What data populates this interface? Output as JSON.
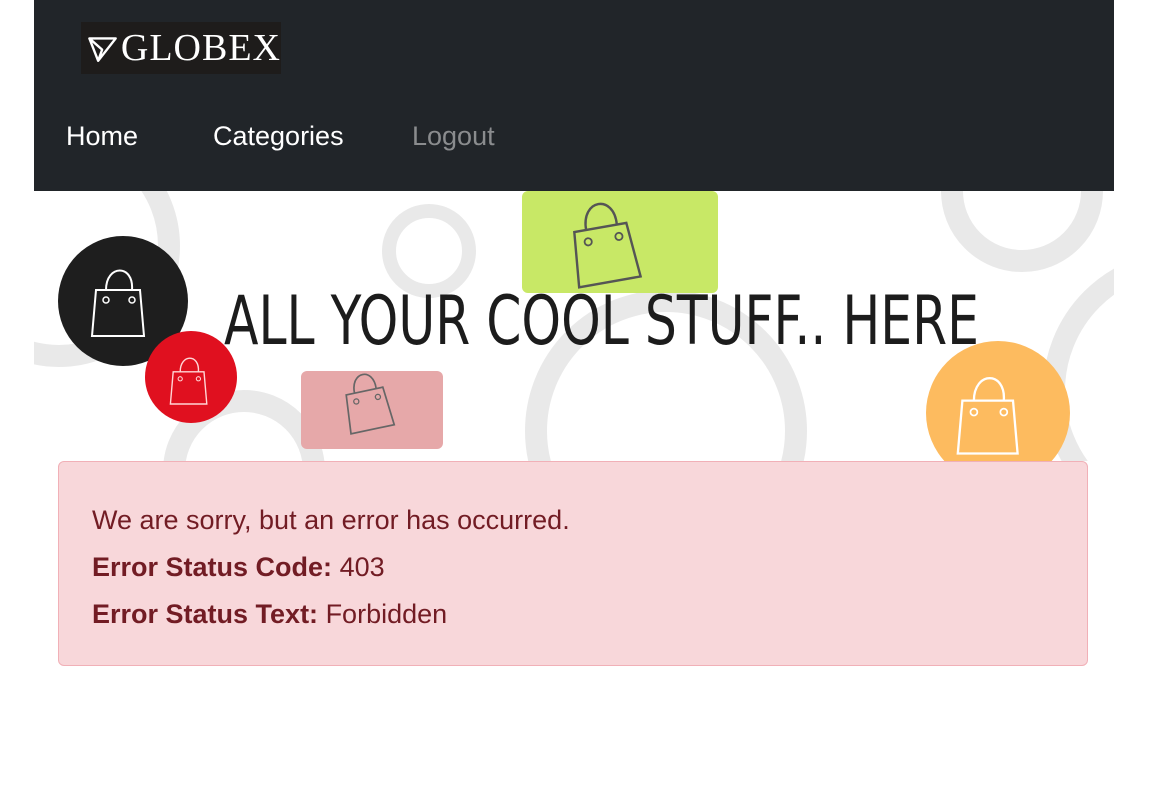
{
  "brand": {
    "name": "GLOBEX",
    "logo_icon": "paper-plane-icon"
  },
  "nav": {
    "items": [
      {
        "label": "Home"
      },
      {
        "label": "Categories"
      },
      {
        "label": "Logout"
      }
    ]
  },
  "hero": {
    "headline": "ALL YOUR COOL STUFF.. HERE",
    "decor_icons": [
      "shopping-bag-icon"
    ],
    "colors": {
      "black_circle": "#1e1e1e",
      "red_circle": "#e0101f",
      "green_square": "#c8e866",
      "pink_square": "#e6a8a9",
      "orange_circle": "#fdbb5f",
      "ring": "#e9e9e9"
    }
  },
  "error": {
    "message": "We are sorry, but an error has occurred.",
    "status_code_label": "Error Status Code:",
    "status_code_value": "403",
    "status_text_label": "Error Status Text:",
    "status_text_value": "Forbidden"
  },
  "colors": {
    "navbar_bg": "#212529",
    "alert_bg": "#f8d7da",
    "alert_border": "#f1b0b7",
    "alert_text": "#721c24"
  }
}
